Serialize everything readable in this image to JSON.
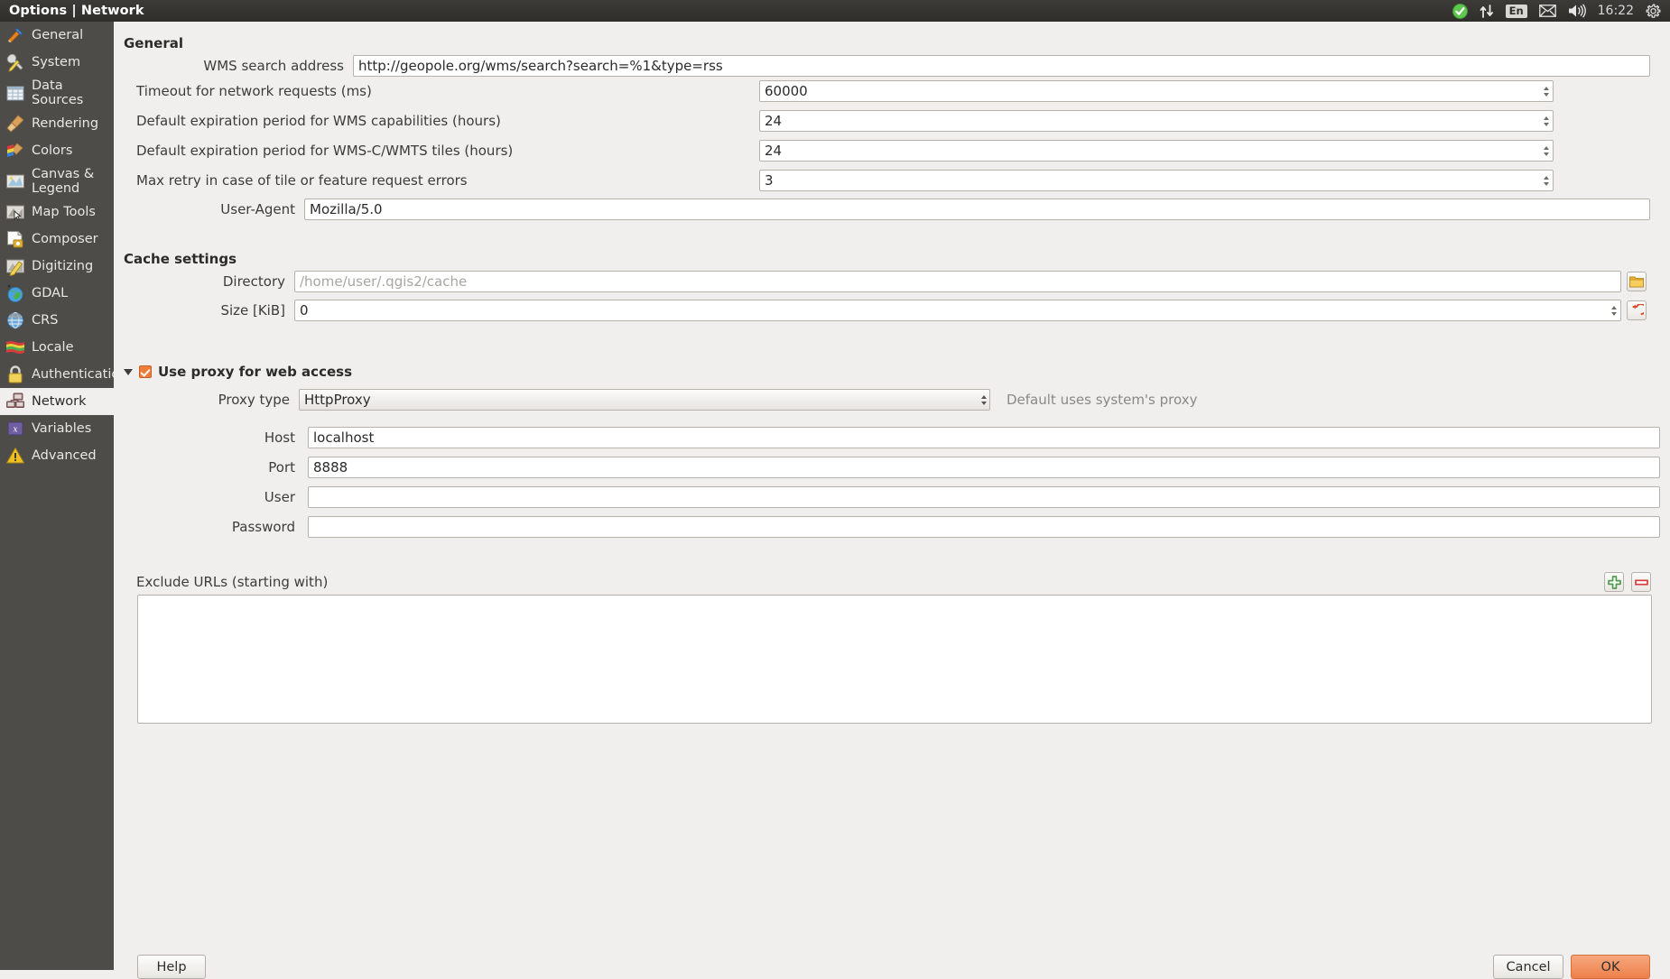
{
  "window": {
    "title": "Options | Network"
  },
  "tray": {
    "check_icon": "checkmark-circle-icon",
    "network_icon": "network-updown-icon",
    "language": "En",
    "mail_icon": "envelope-icon",
    "volume_icon": "speaker-icon",
    "clock": "16:22",
    "power_icon": "gear-power-icon"
  },
  "sidebar": {
    "items": [
      {
        "label": "General",
        "icon": "hammer-screwdriver-icon",
        "selected": false
      },
      {
        "label": "System",
        "icon": "wrench-pencil-icon",
        "selected": false
      },
      {
        "label": "Data Sources",
        "icon": "table-grid-icon",
        "selected": false
      },
      {
        "label": "Rendering",
        "icon": "broom-icon",
        "selected": false
      },
      {
        "label": "Colors",
        "icon": "color-broom-icon",
        "selected": false
      },
      {
        "label": "Canvas &\nLegend",
        "icon": "map-canvas-icon",
        "selected": false
      },
      {
        "label": "Map Tools",
        "icon": "map-cursor-icon",
        "selected": false
      },
      {
        "label": "Composer",
        "icon": "page-compose-icon",
        "selected": false
      },
      {
        "label": "Digitizing",
        "icon": "map-pencil-icon",
        "selected": false
      },
      {
        "label": "GDAL",
        "icon": "globe-green-icon",
        "selected": false
      },
      {
        "label": "CRS",
        "icon": "globe-wire-icon",
        "selected": false
      },
      {
        "label": "Locale",
        "icon": "flags-icon",
        "selected": false
      },
      {
        "label": "Authentication",
        "icon": "padlock-icon",
        "selected": false
      },
      {
        "label": "Network",
        "icon": "computers-network-icon",
        "selected": true
      },
      {
        "label": "Variables",
        "icon": "variables-icon",
        "selected": false
      },
      {
        "label": "Advanced",
        "icon": "warning-triangle-icon",
        "selected": false
      }
    ]
  },
  "general": {
    "heading": "General",
    "wms_search_label": "WMS search address",
    "wms_search_value": "http://geopole.org/wms/search?search=%1&type=rss",
    "timeout_label": "Timeout for network requests (ms)",
    "timeout_value": "60000",
    "wms_cap_label": "Default expiration period for WMS capabilities (hours)",
    "wms_cap_value": "24",
    "wmsc_label": "Default expiration period for WMS-C/WMTS tiles (hours)",
    "wmsc_value": "24",
    "max_retry_label": "Max retry in case of tile or feature request errors",
    "max_retry_value": "3",
    "user_agent_label": "User-Agent",
    "user_agent_value": "Mozilla/5.0"
  },
  "cache": {
    "heading": "Cache settings",
    "directory_label": "Directory",
    "directory_value": "",
    "directory_placeholder": "/home/user/.qgis2/cache",
    "browse_icon": "folder-icon",
    "size_label": "Size [KiB]",
    "size_value": "0",
    "reset_icon": "undo-arrow-icon"
  },
  "proxy": {
    "group_label": "Use proxy for web access",
    "group_checked": true,
    "type_label": "Proxy type",
    "type_value": "HttpProxy",
    "type_hint": "Default uses system's proxy",
    "host_label": "Host",
    "host_value": "localhost",
    "port_label": "Port",
    "port_value": "8888",
    "user_label": "User",
    "user_value": "",
    "password_label": "Password",
    "password_value": "",
    "exclude_label": "Exclude URLs (starting with)",
    "add_icon": "plus-green-icon",
    "remove_icon": "minus-red-icon",
    "exclude_items": []
  },
  "footer": {
    "help_label": "Help",
    "cancel_label": "Cancel",
    "ok_label": "OK"
  },
  "colors": {
    "accent": "#f07c3c",
    "panel_bg": "#f0efee",
    "sidebar_bg": "#4d4c49",
    "titlebar_bg": "#2f2e2b",
    "ok_button": "#ee8049",
    "add_green": "#4f9a4f",
    "remove_red": "#d63c3c"
  }
}
